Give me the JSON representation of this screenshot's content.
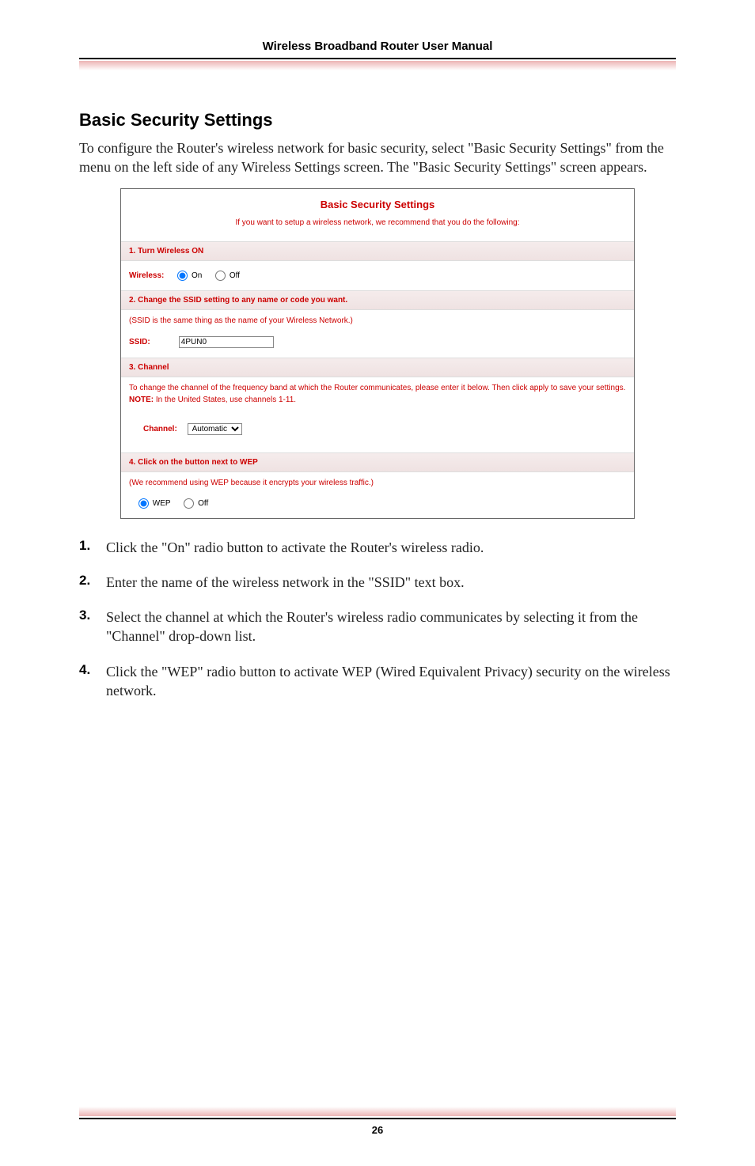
{
  "header": {
    "title": "Wireless Broadband Router User Manual"
  },
  "section": {
    "title": "Basic Security Settings",
    "intro": "To configure the Router's wireless network for basic security, select \"Basic Security Settings\" from the menu on the left side of any Wireless Settings screen. The \"Basic Security Settings\" screen appears."
  },
  "screenshot": {
    "title": "Basic Security Settings",
    "lead": "If you want to setup a wireless network, we recommend that you do the following:",
    "s1": {
      "header": "1. Turn Wireless ON",
      "label": "Wireless:",
      "on": "On",
      "off": "Off"
    },
    "s2": {
      "header": "2. Change the SSID setting to any name or code you want.",
      "note": "(SSID is the same thing as the name of your Wireless Network.)",
      "label": "SSID:",
      "value": "4PUN0"
    },
    "s3": {
      "header": "3. Channel",
      "desc": "To change the channel of the frequency band at which the Router communicates, please enter it below. Then click apply to save your settings.",
      "note_label": "NOTE:",
      "note_text": " In the United States, use channels 1-11.",
      "label": "Channel:",
      "value": "Automatic"
    },
    "s4": {
      "header": "4. Click on the button next to WEP",
      "note": "(We recommend using WEP because it encrypts your wireless traffic.)",
      "wep": "WEP",
      "off": "Off"
    }
  },
  "steps": {
    "i1": {
      "num": "1.",
      "text": "Click the \"On\" radio button to activate the Router's wireless radio."
    },
    "i2": {
      "num": "2.",
      "text_a": "Enter the name of the wireless network in the \"",
      "ssid": "SSID",
      "text_b": "\" text box."
    },
    "i3": {
      "num": "3.",
      "text": "Select the channel at which the Router's wireless radio communicates by selecting it from the \"Channel\" drop-down list."
    },
    "i4": {
      "num": "4.",
      "text_a": "Click the \"",
      "wep1": "WEP",
      "text_b": "\" radio button to activate ",
      "wep2": "WEP",
      "text_c": " (Wired Equivalent Privacy) security on the wireless network."
    }
  },
  "footer": {
    "page": "26"
  }
}
